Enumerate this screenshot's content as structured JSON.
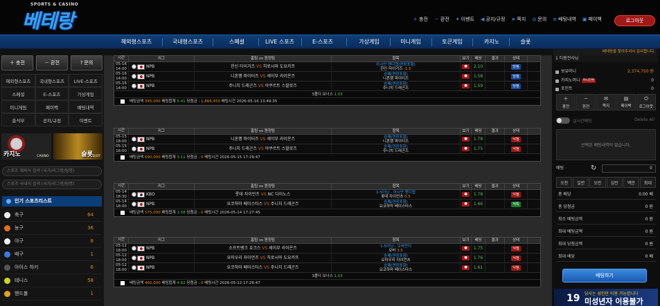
{
  "header": {
    "logo_sub": "SPORTS & CASINO",
    "logo_main": "베테랑",
    "nav": [
      {
        "icon": "plus-icon",
        "label": "충전"
      },
      {
        "icon": "minus-icon",
        "label": "환전"
      },
      {
        "icon": "gift-icon",
        "label": "이벤트"
      },
      {
        "icon": "megaphone-icon",
        "label": "공지/규정"
      },
      {
        "icon": "paper-plane-icon",
        "label": "쪽지"
      },
      {
        "icon": "headset-icon",
        "label": "문의"
      },
      {
        "icon": "list-icon",
        "label": "배팅내역"
      },
      {
        "icon": "money-icon",
        "label": "페이백"
      }
    ],
    "logout": "로그아웃"
  },
  "menu": [
    "해외형스포츠",
    "국내형스포츠",
    "스페셜",
    "LIVE 스포츠",
    "E-스포츠",
    "가상게임",
    "미니게임",
    "토큰게임",
    "카지노",
    "슬롯"
  ],
  "ticker": "베테랑을 찾아주셔서 감사합니다.",
  "sidebar": {
    "quick": [
      {
        "icon": "plus-icon",
        "label": "충전"
      },
      {
        "icon": "minus-icon",
        "label": "환전"
      },
      {
        "icon": "question-icon",
        "label": "문의"
      }
    ],
    "grid": [
      [
        "해외형스포츠",
        "국내형스포츠",
        "LIVE-스포츠"
      ],
      [
        "스페셜",
        "E-스포츠",
        "가상게임"
      ],
      [
        "미니게임",
        "페이백",
        "배팅내역"
      ],
      [
        "출석부",
        "공지/규정",
        "이벤트"
      ]
    ],
    "banners": [
      {
        "label": "카지노",
        "sub": "CASINO"
      },
      {
        "label": "슬롯",
        "sub": "SLOT"
      }
    ],
    "search1": "스포츠 해외식 검색 (국가/리그명/팀명)",
    "search2": "스포츠 국내식 검색 (국가/리그명/팀명)",
    "popular": "인기 스포츠리스트",
    "sports": [
      {
        "name": "축구",
        "count": "64",
        "color": "#eeeeee"
      },
      {
        "name": "농구",
        "count": "36",
        "color": "#e07020"
      },
      {
        "name": "야구",
        "count": "8",
        "color": "#f0f0f0"
      },
      {
        "name": "배구",
        "count": "1",
        "color": "#3a7ae0"
      },
      {
        "name": "아이스 하키",
        "count": "6",
        "color": "#555555"
      },
      {
        "name": "테니스",
        "count": "58",
        "color": "#c8d820"
      },
      {
        "name": "핸드볼",
        "count": "1",
        "color": "#e0a020"
      }
    ]
  },
  "table_headers": [
    "시간",
    "리그",
    "홈팀 vs 원정팀",
    "항목",
    "보기",
    "배당",
    "결과",
    "상태"
  ],
  "blocks": [
    {
      "rows": [
        {
          "date": "05-16",
          "time": "14:00",
          "league": "NPB",
          "flag": "jp",
          "home": "한신 타이거즈",
          "away": "히로시마 도요카프",
          "market": "아시안 핸디캡(연장포함)",
          "pick": "한신 타이거즈",
          "pick_odds": "-1.5",
          "eye": "●",
          "odds": "2.10",
          "result": "",
          "status": "당첨",
          "status_color": "blue"
        },
        {
          "date": "05-16",
          "time": "14:00",
          "league": "NPB",
          "flag": "jp",
          "home": "니혼햄 파이터즈",
          "away": "세이부 라이온즈",
          "market": "승패(연장포함)",
          "pick": "니혼햄 파이터즈",
          "pick_odds": "",
          "eye": "●",
          "odds": "1.58",
          "result": "",
          "status": "당첨",
          "status_color": "blue"
        },
        {
          "date": "05-16",
          "time": "14:00",
          "league": "NPB",
          "flag": "jp",
          "home": "주니치 드래곤즈",
          "away": "야쿠르트 스왈로즈",
          "market": "승패(연장포함)",
          "pick": "주니치 드래곤즈",
          "pick_odds": "",
          "eye": "●",
          "odds": "1.59",
          "result": "",
          "status": "당첨",
          "status_color": "blue"
        }
      ],
      "bonus": "3폴더 보너스",
      "bonus_val": "1.03",
      "footer": {
        "amount_label": "배팅금액",
        "amount": "345,000",
        "total_label": "배팅합계",
        "total": "5.41",
        "win_label": "당첨금",
        "win": "1,866,450",
        "time_label": "배팅시간",
        "time": "2026-05-16 13:49:35"
      }
    },
    {
      "rows": [
        {
          "date": "05-15",
          "time": "18:00",
          "league": "NPB",
          "flag": "jp",
          "home": "니혼햄 파이터즈",
          "away": "세이부 라이온즈",
          "market": "승패(연장포함)",
          "pick": "니혼햄 파이터즈",
          "pick_odds": "",
          "eye": "●",
          "odds": "1.78",
          "result": "",
          "status": "낙첨",
          "status_color": "red"
        },
        {
          "date": "05-15",
          "time": "18:00",
          "league": "NPB",
          "flag": "jp",
          "home": "주니치 드래곤즈",
          "away": "야쿠르트 스왈로즈",
          "market": "승패(연장포함)",
          "pick": "주니치 드래곤즈",
          "pick_odds": "",
          "eye": "●",
          "odds": "1.75",
          "result": "",
          "status": "낙첨",
          "status_color": "red"
        }
      ],
      "bonus": "",
      "bonus_val": "",
      "footer": {
        "amount_label": "배팅금액",
        "amount": "690,000",
        "total_label": "배팅합계",
        "total": "3.11",
        "win_label": "당첨금",
        "win": "0",
        "time_label": "배팅시간",
        "time": "2026-05-15 17:29:47"
      }
    },
    {
      "rows": [
        {
          "date": "05-14",
          "time": "18:30",
          "league": "KBO",
          "flag": "kr",
          "home": "롯데 자이언츠",
          "away": "NC 다이노스",
          "market": "1-5이닝 - 아시안 핸디캡",
          "pick": "롯데 자이언츠",
          "pick_odds": "0.5",
          "eye": "●",
          "odds": "1.78",
          "result": "",
          "status": "낙첨",
          "status_color": "red"
        },
        {
          "date": "05-14",
          "time": "18:00",
          "league": "NPB",
          "flag": "jp",
          "home": "요코하마 베이스타스",
          "away": "주니치 드래곤즈",
          "market": "승패(연장포함)",
          "pick": "요코하마 베이스타스",
          "pick_odds": "",
          "eye": "●",
          "odds": "1.66",
          "result": "",
          "status": "적특",
          "status_color": "green"
        }
      ],
      "bonus": "",
      "bonus_val": "",
      "footer": {
        "amount_label": "배팅금액",
        "amount": "575,000",
        "total_label": "배팅합계",
        "total": "1.58",
        "win_label": "당첨금",
        "win": "0",
        "time_label": "배팅시간",
        "time": "2026-05-14 17:27:45"
      }
    },
    {
      "rows": [
        {
          "date": "05-12",
          "time": "18:00",
          "league": "NPB",
          "flag": "jp",
          "home": "소프트뱅크 호크스",
          "away": "세이부 라이온즈",
          "market": "1-5이닝 - 오버언더",
          "pick": "오버",
          "pick_odds": "3.5",
          "eye": "●",
          "odds": "1.75",
          "result": "",
          "status": "낙첨",
          "status_color": "red"
        },
        {
          "date": "05-12",
          "time": "18:00",
          "league": "NPB",
          "flag": "jp",
          "home": "요미우리 자이언츠",
          "away": "히로시마 도요카프",
          "market": "승패(연장포함)",
          "pick": "요미우리 자이언츠",
          "pick_odds": "",
          "eye": "●",
          "odds": "1.76",
          "result": "",
          "status": "낙첨",
          "status_color": "red"
        },
        {
          "date": "05-12",
          "time": "18:00",
          "league": "NPB",
          "flag": "jp",
          "home": "요코하마 베이스타스",
          "away": "주니치 드래곤즈",
          "market": "승패(연장포함)",
          "pick": "요코하마 베이스타스",
          "pick_odds": "",
          "eye": "●",
          "odds": "1.61",
          "result": "",
          "status": "낙첨",
          "status_color": "red"
        }
      ],
      "bonus": "3폴더 보너스",
      "bonus_val": "1.03",
      "footer": {
        "amount_label": "배팅금액",
        "amount": "460,000",
        "total_label": "배팅합계",
        "total": "4.62",
        "win_label": "당첨금",
        "win": "0",
        "time_label": "배팅시간",
        "time": "2026-05-12 17:26:47"
      }
    }
  ],
  "right": {
    "top": "1 티원전사님",
    "account": [
      {
        "label": "보유머니",
        "value": "2,374,750",
        "unit": "원",
        "tag": ""
      },
      {
        "label": "카지노머니",
        "value": "0",
        "unit": "",
        "tag": "머니전환"
      },
      {
        "label": "포인트",
        "value": "0",
        "unit": "",
        "tag": ""
      }
    ],
    "buttons": [
      {
        "icon": "plus-icon",
        "label": "충전"
      },
      {
        "icon": "minus-icon",
        "label": "환전"
      },
      {
        "icon": "envelope-icon",
        "label": "쪽지"
      },
      {
        "icon": "wallet-icon",
        "label": "페이백"
      },
      {
        "icon": "power-icon",
        "label": "로그아웃"
      }
    ],
    "slip_label": "실시간배팅",
    "delete_all": "Delete All",
    "empty": "선택된 배팅내역이 없습니다.",
    "bet_label": "배팅",
    "bet_amount": "0",
    "chips": [
      "오천",
      "일만",
      "오만",
      "십만",
      "백만",
      "최대"
    ],
    "summary": [
      {
        "label": "총 배당",
        "value": "0.00 배"
      },
      {
        "label": "총 당첨금",
        "value": "0 원"
      },
      {
        "label": "최소 배팅금액",
        "value": "0 원"
      },
      {
        "label": "최대 배팅금액",
        "value": "0 원"
      },
      {
        "label": "최대 당첨금액",
        "value": "0 원"
      },
      {
        "label": "최대 배당",
        "value": "0 배"
      }
    ],
    "place_bet": "배팅하기",
    "promo": {
      "number": "19",
      "line1": "당사는 성인만 이용 가능합니다",
      "line2": "미성년자 이용불가"
    }
  }
}
